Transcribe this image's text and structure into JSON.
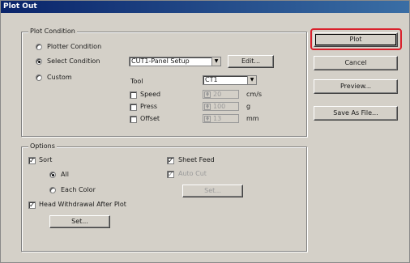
{
  "window": {
    "title": "Plot Out"
  },
  "plot_condition": {
    "group_label": "Plot Condition",
    "radio_plotter": "Plotter Condition",
    "radio_select": "Select Condition",
    "radio_custom": "Custom",
    "select_value": "CUT1-Panel Setup",
    "edit_button": "Edit...",
    "tool_label": "Tool",
    "tool_value": "CT1",
    "speed_label": "Speed",
    "speed_value": "20",
    "speed_unit": "cm/s",
    "press_label": "Press",
    "press_value": "100",
    "press_unit": "g",
    "offset_label": "Offset",
    "offset_value": "13",
    "offset_unit": "mm"
  },
  "options": {
    "group_label": "Options",
    "sort_label": "Sort",
    "all_label": "All",
    "each_color_label": "Each Color",
    "head_withdrawal_label": "Head Withdrawal After Plot",
    "set_button_1": "Set...",
    "sheet_feed_label": "Sheet Feed",
    "auto_cut_label": "Auto Cut",
    "set_button_2": "Set..."
  },
  "actions": {
    "plot": "Plot",
    "cancel": "Cancel",
    "preview": "Preview...",
    "save_as_file": "Save As File..."
  },
  "colors": {
    "highlight": "#d9202b",
    "titlebar": "#0a246a"
  }
}
